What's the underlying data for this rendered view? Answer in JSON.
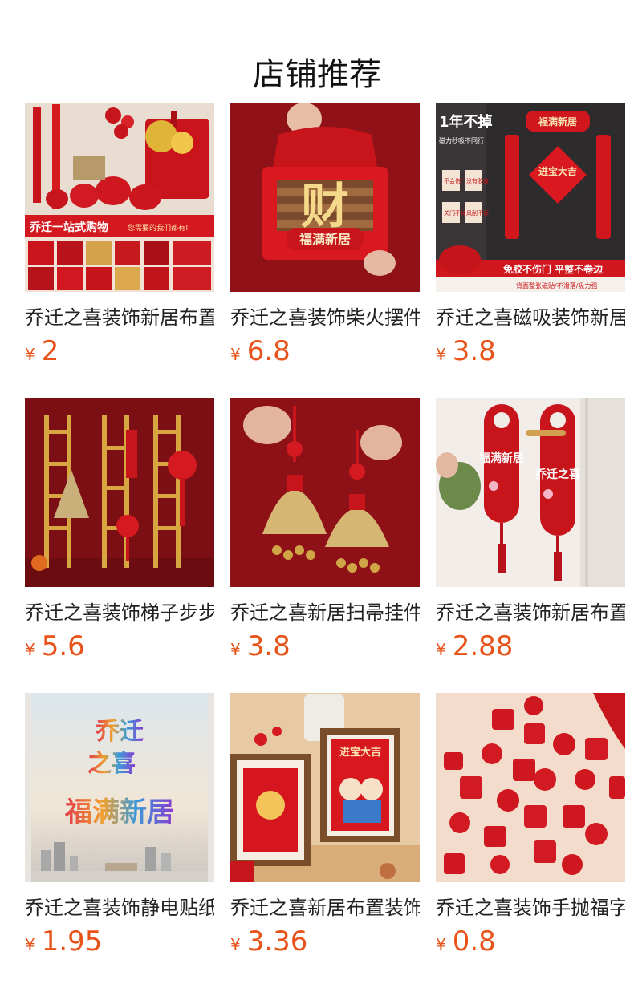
{
  "page": {
    "title": "店铺推荐"
  },
  "colors": {
    "price": "#e8531a",
    "title": "#222222",
    "heading": "#111111"
  },
  "products": [
    {
      "title": "乔迁之喜装饰新居布置",
      "currency": "¥",
      "price": "2",
      "image_text": [
        "乔迁一站式购物",
        "您需要的我们都有!"
      ]
    },
    {
      "title": "乔迁之喜装饰柴火摆件",
      "currency": "¥",
      "price": "6.8",
      "image_text": [
        "财",
        "福满新居"
      ]
    },
    {
      "title": "乔迁之喜磁吸装饰新居",
      "currency": "¥",
      "price": "3.8",
      "image_text": [
        "1年不掉",
        "磁力秒吸不同行",
        "福满新居",
        "进宝大吉",
        "不会伤门",
        "没有胶痕",
        "关门不掉",
        "风刮不掉",
        "免胶不伤门 平整不卷边",
        "背面整张磁贴/不滑落/吸力强"
      ]
    },
    {
      "title": "乔迁之喜装饰梯子步步高",
      "currency": "¥",
      "price": "5.6",
      "image_text": []
    },
    {
      "title": "乔迁之喜新居扫帚挂件",
      "currency": "¥",
      "price": "3.8",
      "image_text": []
    },
    {
      "title": "乔迁之喜装饰新居布置",
      "currency": "¥",
      "price": "2.88",
      "image_text": [
        "福满新居",
        "乔迁之喜"
      ]
    },
    {
      "title": "乔迁之喜装饰静电贴纸",
      "currency": "¥",
      "price": "1.95",
      "image_text": [
        "乔迁",
        "之喜",
        "福满新居"
      ]
    },
    {
      "title": "乔迁之喜新居布置装饰画",
      "currency": "¥",
      "price": "3.36",
      "image_text": [
        "进宝大吉"
      ]
    },
    {
      "title": "乔迁之喜装饰手抛福字",
      "currency": "¥",
      "price": "0.8",
      "image_text": []
    }
  ]
}
